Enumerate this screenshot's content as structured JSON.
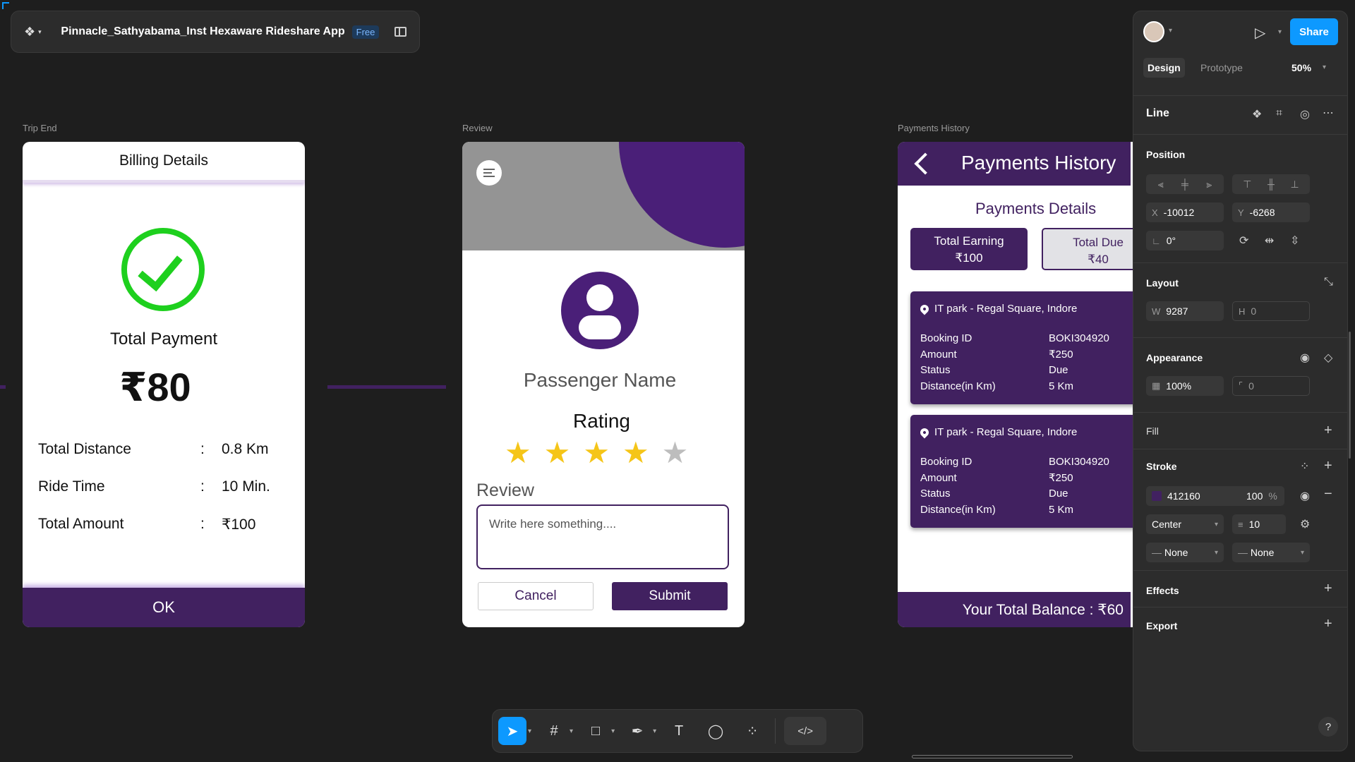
{
  "file": {
    "name": "Pinnacle_Sathyabama_Inst Hexaware Rideshare App",
    "plan_badge": "Free"
  },
  "frames": {
    "trip_end": {
      "label": "Trip End",
      "header": "Billing Details",
      "total_payment_label": "Total Payment",
      "total_payment_value": "₹80",
      "rows": [
        {
          "key": "Total Distance",
          "sep": ":",
          "value": "0.8 Km"
        },
        {
          "key": "Ride Time",
          "sep": ":",
          "value": "10 Min."
        },
        {
          "key": "Total Amount",
          "sep": ":",
          "value": "₹100"
        }
      ],
      "ok_label": "OK"
    },
    "review": {
      "label": "Review",
      "passenger_name": "Passenger Name",
      "rating_label": "Rating",
      "rating": 4,
      "rating_max": 5,
      "review_label": "Review",
      "review_placeholder": "Write here something....",
      "cancel_label": "Cancel",
      "submit_label": "Submit"
    },
    "payments": {
      "label": "Payments History",
      "title": "Payments History",
      "details_title": "Payments Details",
      "earning_label": "Total Earning",
      "earning_value": "₹100",
      "due_label": "Total Due",
      "due_value": "₹40",
      "bookings": [
        {
          "place": "IT park - Regal Square, Indore",
          "keys": [
            "Booking ID",
            "Amount",
            "Status",
            "Distance(in Km)"
          ],
          "values": [
            "BOKI304920",
            "₹250",
            "Due",
            "5 Km"
          ]
        },
        {
          "place": "IT park - Regal Square, Indore",
          "keys": [
            "Booking ID",
            "Amount",
            "Status",
            "Distance(in Km)"
          ],
          "values": [
            "BOKI304920",
            "₹250",
            "Due",
            "5 Km"
          ]
        }
      ],
      "balance": "Your Total Balance : ₹60"
    }
  },
  "panel": {
    "share_label": "Share",
    "tabs": [
      "Design",
      "Prototype"
    ],
    "zoom": "50%",
    "selection": "Line",
    "position": {
      "title": "Position",
      "x_label": "X",
      "x": "-10012",
      "y_label": "Y",
      "y": "-6268",
      "rotation": "0°"
    },
    "layout": {
      "title": "Layout",
      "w_label": "W",
      "w": "9287",
      "h_label": "H",
      "h": "0"
    },
    "appearance": {
      "title": "Appearance",
      "opacity": "100%",
      "radius": "0"
    },
    "fill": {
      "title": "Fill"
    },
    "stroke": {
      "title": "Stroke",
      "color": "412160",
      "opacity": "100",
      "pct": "%",
      "align": "Center",
      "weight": "10",
      "start": "None",
      "end": "None"
    },
    "effects": {
      "title": "Effects"
    },
    "export": {
      "title": "Export"
    }
  },
  "colors": {
    "brand": "#412160",
    "accent": "#0d99ff",
    "check": "#1ed01e",
    "star": "#f5c518"
  }
}
